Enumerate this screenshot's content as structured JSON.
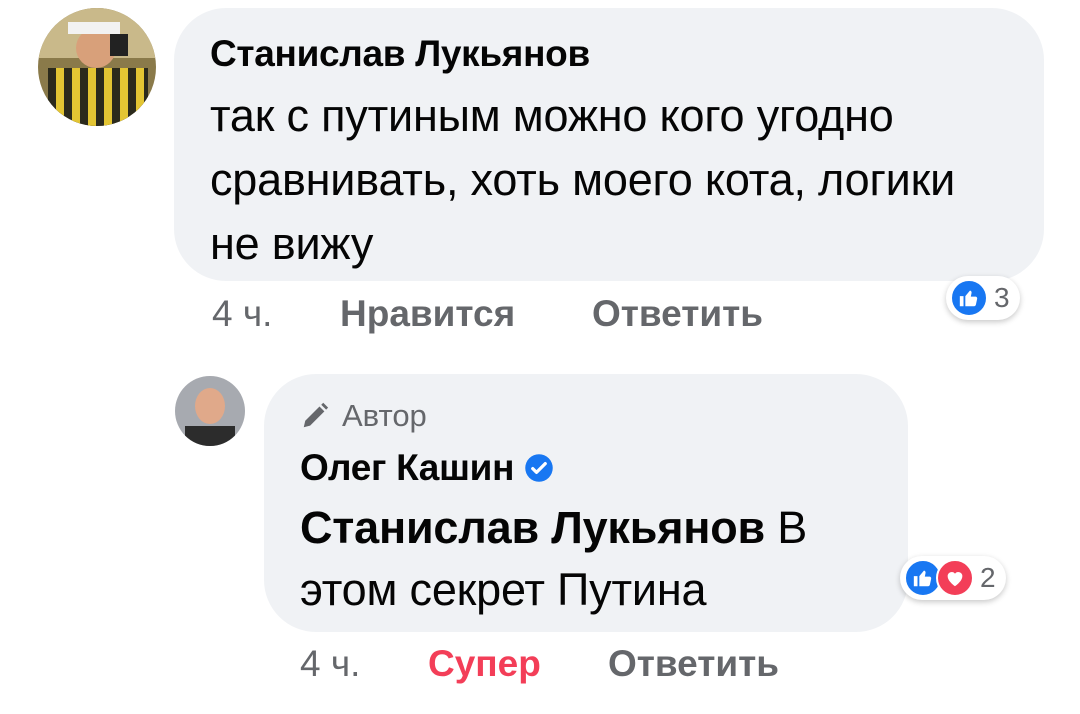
{
  "comment": {
    "author": "Станислав Лукьянов",
    "text": "так с путиным можно кого угодно сравнивать, хоть моего кота, логики не вижу",
    "time": "4 ч.",
    "like_label": "Нравится",
    "reply_label": "Ответить",
    "reaction_count": "3"
  },
  "reply": {
    "badge": "Автор",
    "author": "Олег Кашин",
    "mention": "Станислав Лукьянов",
    "text": " В этом секрет Путина",
    "time": "4 ч.",
    "reaction_label": "Супер",
    "reply_label": "Ответить",
    "reaction_count": "2"
  },
  "icons": {
    "like": "like-icon",
    "love": "heart-icon",
    "verified": "verified-badge-icon",
    "author": "pencil-icon"
  },
  "colors": {
    "bubble": "#f0f2f5",
    "text": "#050505",
    "secondary": "#65676b",
    "like": "#1877f2",
    "love": "#f33e58"
  }
}
